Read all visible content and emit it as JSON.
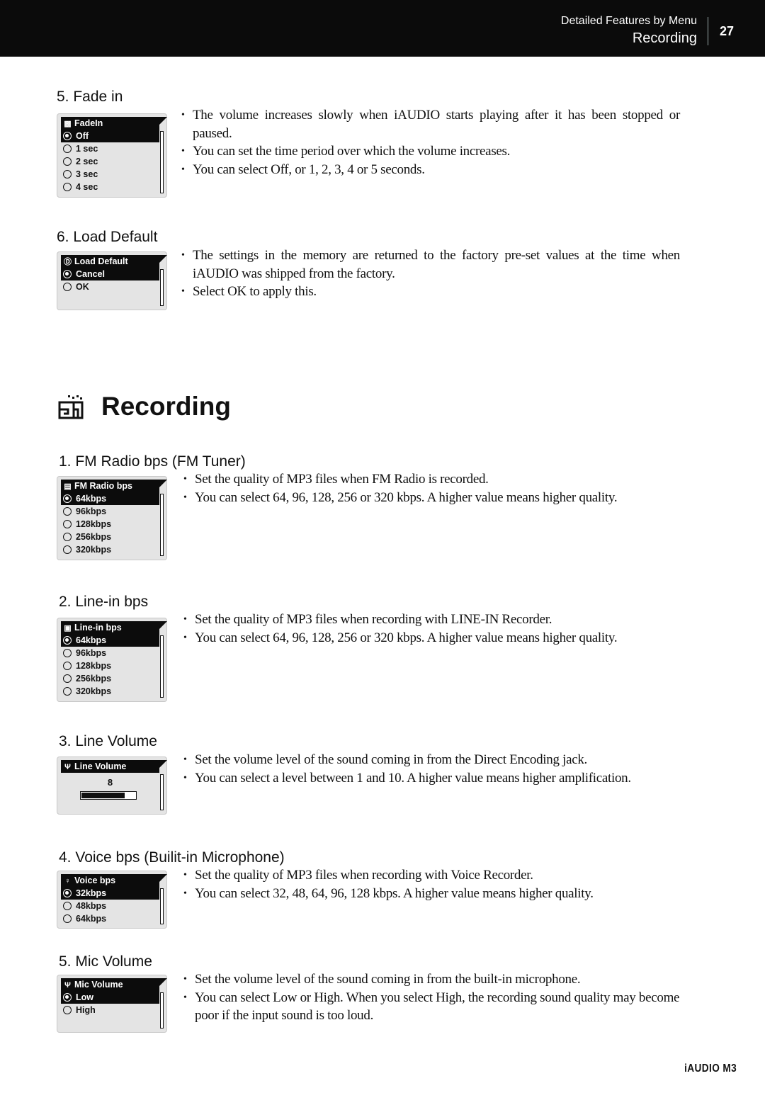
{
  "header": {
    "section": "Detailed Features by Menu",
    "subsection": "Recording",
    "page_number": "27"
  },
  "settings": [
    {
      "title": "5. Fade in",
      "screen": {
        "title": "FadeIn",
        "icon": "fade-in-icon",
        "options": [
          "Off",
          "1 sec",
          "2 sec",
          "3 sec",
          "4 sec"
        ],
        "selected": "Off"
      },
      "bullets": [
        "The volume increases slowly when iAUDIO starts playing after it has been stopped or paused.",
        "You can set the time period over which the volume increases.",
        "You can select Off, or 1, 2, 3, 4 or 5 seconds."
      ]
    },
    {
      "title": "6. Load Default",
      "screen": {
        "title": "Load Default",
        "icon": "load-default-icon",
        "options": [
          "Cancel",
          "OK"
        ],
        "selected": "Cancel"
      },
      "bullets": [
        "The settings in the memory are returned to the factory pre-set values at the time when iAUDIO was shipped from the factory.",
        "Select OK to apply this."
      ]
    }
  ],
  "recording": {
    "heading": "Recording",
    "icon": "recording-icon",
    "items": [
      {
        "title": "1. FM Radio bps (FM Tuner)",
        "screen": {
          "title": "FM Radio bps",
          "icon": "fm-radio-icon",
          "options": [
            "64kbps",
            "96kbps",
            "128kbps",
            "256kbps",
            "320kbps"
          ],
          "selected": "64kbps"
        },
        "bullets": [
          "Set the quality of MP3 files when FM Radio is recorded.",
          "You can select 64, 96, 128, 256 or 320 kbps. A higher value means higher quality."
        ]
      },
      {
        "title": "2. Line-in bps",
        "screen": {
          "title": "Line-in  bps",
          "icon": "line-in-icon",
          "options": [
            "64kbps",
            "96kbps",
            "128kbps",
            "256kbps",
            "320kbps"
          ],
          "selected": "64kbps"
        },
        "bullets": [
          "Set the quality of MP3 files when recording with LINE-IN Recorder.",
          "You can select 64, 96, 128, 256 or 320 kbps. A higher value means higher quality."
        ]
      },
      {
        "title": "3. Line Volume",
        "screen": {
          "title": "Line Volume",
          "icon": "line-volume-icon",
          "value": "8",
          "level_fraction": 0.8
        },
        "bullets": [
          "Set the volume level of the sound coming in from the Direct Encoding jack.",
          "You can select a level between 1 and 10. A higher value means higher amplification."
        ]
      },
      {
        "title": "4. Voice bps (Builit-in Microphone)",
        "screen": {
          "title": "Voice  bps",
          "icon": "voice-microphone-icon",
          "options": [
            "32kbps",
            "48kbps",
            "64kbps"
          ],
          "selected": "32kbps"
        },
        "bullets": [
          "Set the quality of MP3 files when recording with Voice Recorder.",
          "You can select 32, 48, 64, 96, 128 kbps. A higher value means higher quality."
        ]
      },
      {
        "title": "5. Mic Volume",
        "screen": {
          "title": "Mic Volume",
          "icon": "mic-volume-icon",
          "options": [
            "Low",
            "High"
          ],
          "selected": "Low"
        },
        "bullets": [
          "Set the volume level of the sound coming in from the built-in microphone.",
          "You can select Low or High. When you select High, the recording sound quality may become poor if the input sound is too loud."
        ]
      }
    ]
  },
  "footer": {
    "product": "iAUDIO M3"
  }
}
